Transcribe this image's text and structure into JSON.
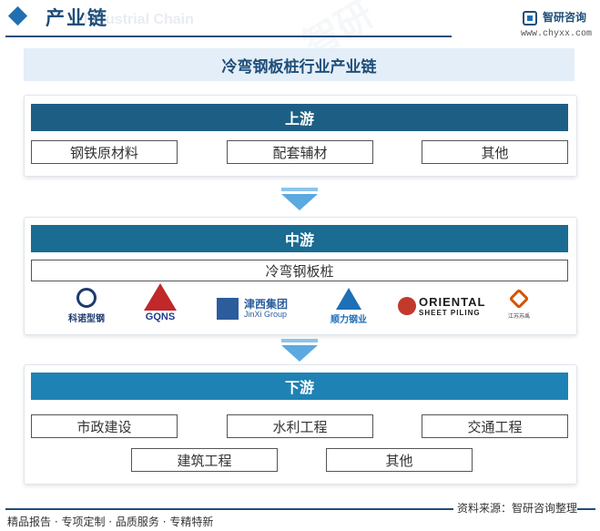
{
  "header": {
    "title": "产业链",
    "subtitle": "Industrial Chain",
    "brand_name": "智研咨询",
    "brand_url": "www.chyxx.com"
  },
  "main_title": "冷弯钢板桩行业产业链",
  "upstream": {
    "label": "上游",
    "items": [
      "钢铁原材料",
      "配套辅材",
      "其他"
    ]
  },
  "midstream": {
    "label": "中游",
    "product": "冷弯钢板桩",
    "companies": {
      "kenuo": "科诺型钢",
      "gqns": "GQNS",
      "jinxi_cn": "津西集团",
      "jinxi_en": "JinXi Group",
      "shunli": "顺力钢业",
      "oriental": "ORIENTAL",
      "oriental_sub": "SHEET PILING",
      "jiangsu": "江苏苏禹"
    }
  },
  "downstream": {
    "label": "下游",
    "items": [
      "市政建设",
      "水利工程",
      "交通工程",
      "建筑工程",
      "其他"
    ]
  },
  "footer": {
    "left": "精品报告 · 专项定制 · 品质服务 · 专精特新",
    "source": "资料来源：智研咨询整理"
  },
  "colors": {
    "upstream_bar": "#1d5f84",
    "midstream_bar": "#1a6c92",
    "downstream_bar": "#1f82b4",
    "arrow": "#5aa9e0"
  }
}
